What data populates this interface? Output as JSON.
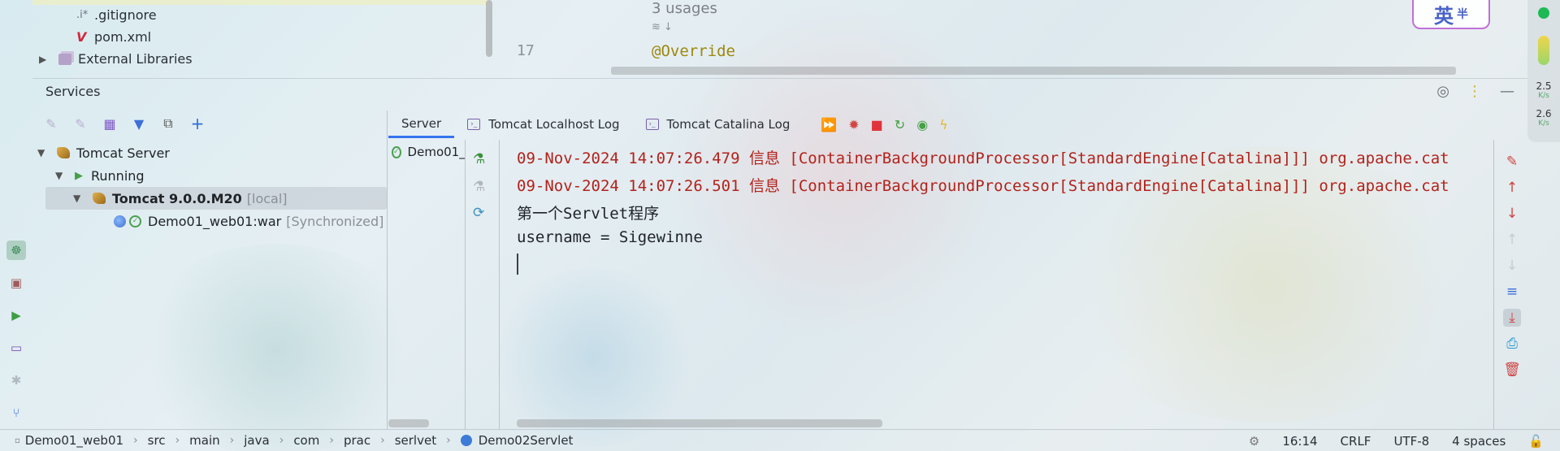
{
  "project_tree": {
    "gitignore": ".gitignore",
    "pom": "pom.xml",
    "external_libraries": "External Libraries"
  },
  "editor": {
    "usages": "3 usages",
    "line_number": "17",
    "code": "@Override"
  },
  "ime": {
    "label": "英",
    "sub": "半"
  },
  "net_speed": {
    "up": "2.5",
    "up_unit": "K/s",
    "down": "2.6",
    "down_unit": "K/s"
  },
  "services": {
    "title": "Services",
    "tree": {
      "server": "Tomcat Server",
      "running": "Running",
      "instance": "Tomcat 9.0.0.M20",
      "instance_tag": "[local]",
      "artifact": "Demo01_web01:war",
      "artifact_status": "[Synchronized]"
    }
  },
  "console_tabs": {
    "server": "Server",
    "localhost_log": "Tomcat Localhost Log",
    "catalina_log": "Tomcat Catalina Log"
  },
  "deployment": {
    "item": "Demo01_"
  },
  "console": {
    "lines": [
      "09-Nov-2024 14:07:26.479 信息 [ContainerBackgroundProcessor[StandardEngine[Catalina]]] org.apache.cat",
      "09-Nov-2024 14:07:26.501 信息 [ContainerBackgroundProcessor[StandardEngine[Catalina]]] org.apache.cat",
      "第一个Servlet程序",
      "username = Sigewinne"
    ]
  },
  "statusbar": {
    "crumbs": [
      "Demo01_web01",
      "src",
      "main",
      "java",
      "com",
      "prac",
      "serlvet",
      "Demo02Servlet"
    ],
    "position": "16:14",
    "line_sep": "CRLF",
    "encoding": "UTF-8",
    "indent": "4 spaces"
  },
  "colors": {
    "log_red": "#b3221b",
    "accent": "#3574f0",
    "run_green": "#46a047",
    "stop_red": "#e0333b"
  }
}
